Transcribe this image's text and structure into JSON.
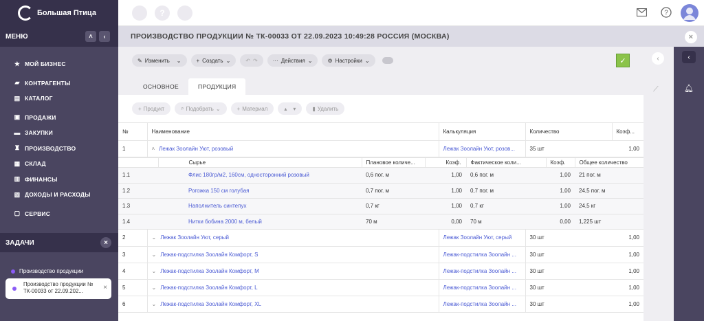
{
  "app": {
    "name": "Большая Птица"
  },
  "sidebar": {
    "menu_title": "МЕНЮ",
    "items": [
      {
        "label": "МОЙ БИЗНЕС",
        "icon": "star-icon"
      },
      {
        "label": "КОНТРАГЕНТЫ",
        "icon": "briefcase-icon"
      },
      {
        "label": "КАТАЛОГ",
        "icon": "catalog-icon"
      },
      {
        "label": "ПРОДАЖИ",
        "icon": "cart-icon"
      },
      {
        "label": "ЗАКУПКИ",
        "icon": "truck-icon"
      },
      {
        "label": "ПРОИЗВОДСТВО",
        "icon": "factory-icon"
      },
      {
        "label": "СКЛАД",
        "icon": "warehouse-icon"
      },
      {
        "label": "ФИНАНСЫ",
        "icon": "finance-icon"
      },
      {
        "label": "ДОХОДЫ И РАСХОДЫ",
        "icon": "wallet-icon"
      },
      {
        "label": "СЕРВИС",
        "icon": "service-icon"
      }
    ],
    "tasks_title": "ЗАДАЧИ",
    "tasks": [
      {
        "label": "Производство продукции"
      },
      {
        "label": "Производство продукции № ТК-00033 от 22.09.202..."
      }
    ]
  },
  "topbar": {
    "help_symbol": "?"
  },
  "header": {
    "title": "ПРОИЗВОДСТВО ПРОДУКЦИИ № ТК-00033 ОТ 22.09.2023 10:49:28 РОССИЯ (МОСКВА)"
  },
  "toolbar": {
    "edit": "Изменить",
    "create": "Создать",
    "actions": "Действия",
    "settings": "Настройки"
  },
  "tabs": [
    "ОСНОВНОЕ",
    "ПРОДУКЦИЯ"
  ],
  "subbar": {
    "product": "Продукт",
    "pick": "Подобрать",
    "material": "Материал",
    "delete": "Удалить"
  },
  "table": {
    "headers": {
      "num": "№",
      "name": "Наименование",
      "calc": "Калькуляция",
      "qty": "Количество",
      "coef": "Коэф..."
    },
    "expanded_row": {
      "num": "1",
      "name": "Лежак Зоолайн Уют, розовый",
      "calc": "Лежак Зоолайн Уют, розов...",
      "qty": "35 шт",
      "coef": "1,00"
    },
    "sub_headers": {
      "raw": "Сырье",
      "planned": "Плановое количе...",
      "coef1": "Коэф.",
      "actual": "Фактическое коли...",
      "coef2": "Коэф.",
      "total": "Общее количество"
    },
    "sub_rows": [
      {
        "num": "1.1",
        "raw": "Флис 180гр/м2, 160см, односторонний розовый",
        "planned": "0,6 пог. м",
        "coef1": "1,00",
        "actual": "0,6 пог. м",
        "coef2": "1,00",
        "total": "21 пог. м"
      },
      {
        "num": "1.2",
        "raw": "Рогожка 150 см голубая",
        "planned": "0,7 пог. м",
        "coef1": "1,00",
        "actual": "0,7 пог. м",
        "coef2": "1,00",
        "total": "24,5 пог. м"
      },
      {
        "num": "1.3",
        "raw": "Наполнитель синтепух",
        "planned": "0,7 кг",
        "coef1": "1,00",
        "actual": "0,7 кг",
        "coef2": "1,00",
        "total": "24,5 кг"
      },
      {
        "num": "1.4",
        "raw": "Нитки бобина 2000 м, белый",
        "planned": "70 м",
        "coef1": "0,00",
        "actual": "70 м",
        "coef2": "0,00",
        "total": "1,225 шт"
      }
    ],
    "rows": [
      {
        "num": "2",
        "name": "Лежак Зоолайн Уют, серый",
        "calc": "Лежак Зоолайн Уют, серый",
        "qty": "30 шт",
        "coef": "1,00"
      },
      {
        "num": "3",
        "name": "Лежак-подстилка Зоолайн Комфорт, S",
        "calc": "Лежак-подстилка Зоолайн ...",
        "qty": "30 шт",
        "coef": "1,00"
      },
      {
        "num": "4",
        "name": "Лежак-подстилка Зоолайн Комфорт, M",
        "calc": "Лежак-подстилка Зоолайн ...",
        "qty": "30 шт",
        "coef": "1,00"
      },
      {
        "num": "5",
        "name": "Лежак-подстилка Зоолайн Комфорт, L",
        "calc": "Лежак-подстилка Зоолайн ...",
        "qty": "30 шт",
        "coef": "1,00"
      },
      {
        "num": "6",
        "name": "Лежак-подстилка Зоолайн Комфорт, XL",
        "calc": "Лежак-подстилка Зоолайн ...",
        "qty": "30 шт",
        "coef": "1,00"
      }
    ]
  },
  "colors": {
    "sidebar_bg": "#4a4560",
    "sidebar_dark": "#36314b",
    "link": "#4b5bd4",
    "header_bg": "#dcdbe5",
    "confirm": "#8bc34a",
    "task_dot": "#8b5cf6"
  }
}
